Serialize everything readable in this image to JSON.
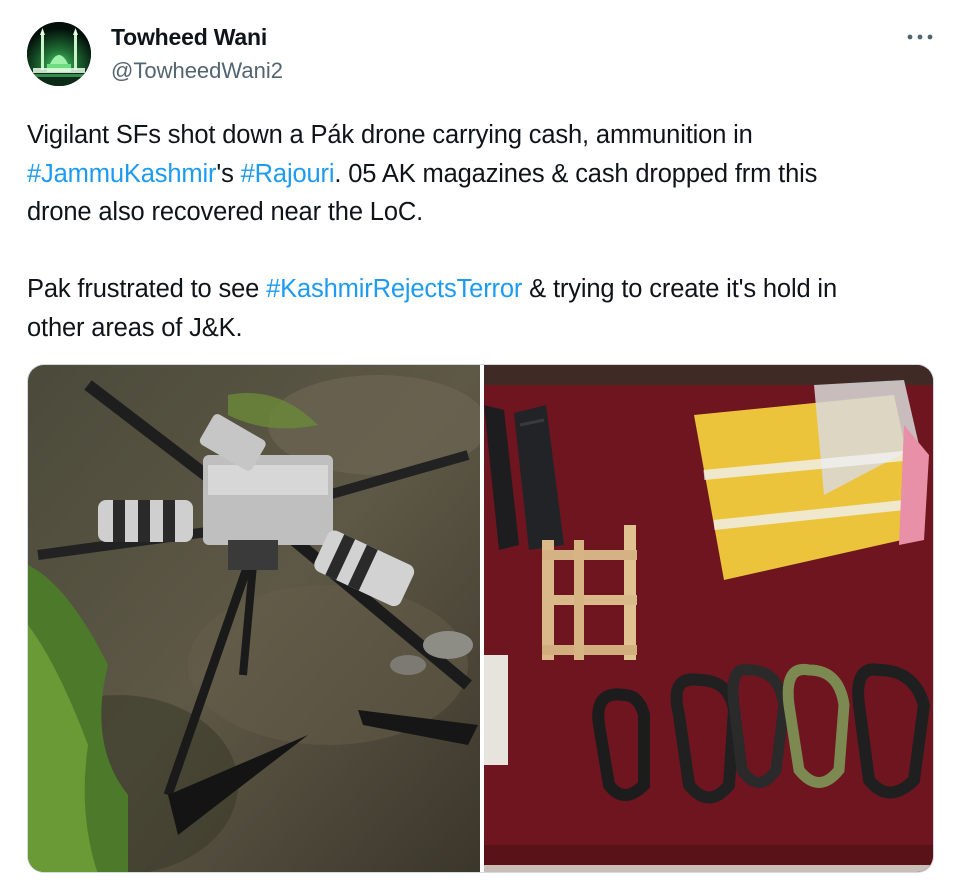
{
  "user": {
    "name": "Towheed Wani",
    "handle": "@TowheedWani2",
    "avatar_icon": "mosque-night-avatar"
  },
  "more_icon": "more-dots-icon",
  "tweet": {
    "line1": "Vigilant SFs shot down a Pák drone carrying cash, ammunition in",
    "line2_tag1": "#JammuKashmir",
    "line2_mid1": "'s ",
    "line2_tag2": "#Rajouri",
    "line2_rest": ". 05 AK magazines & cash dropped frm this",
    "line3": "drone also recovered near the LoC.",
    "line4_pre": "Pak frustrated to see ",
    "line4_tag": "#KashmirRejectsTerror",
    "line4_post": " & trying to create it's hold in",
    "line5": "other areas of J&K."
  },
  "colors": {
    "hashtag": "#1d9bf0",
    "text": "#0f1419",
    "secondary": "#536471"
  },
  "media": [
    {
      "icon": "downed-drone-photo"
    },
    {
      "icon": "recovered-items-photo"
    }
  ]
}
